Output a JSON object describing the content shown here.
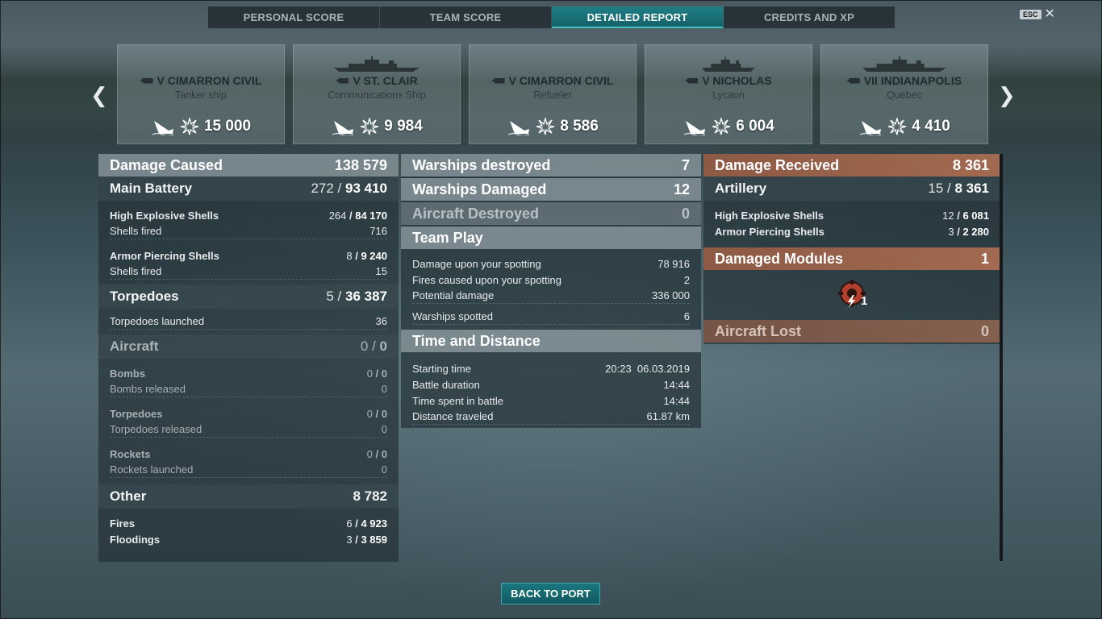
{
  "tabs": [
    {
      "label": "PERSONAL SCORE",
      "active": false
    },
    {
      "label": "TEAM SCORE",
      "active": false
    },
    {
      "label": "DETAILED REPORT",
      "active": true
    },
    {
      "label": "CREDITS AND XP",
      "active": false
    }
  ],
  "esc": {
    "key_label": "ESC",
    "close_glyph": "✕"
  },
  "carousel": {
    "prev_glyph": "❮",
    "next_glyph": "❯",
    "cards": [
      {
        "name": "V CIMARRON CIVIL",
        "class": "Tanker ship",
        "damage": "15 000"
      },
      {
        "name": "V ST. CLAIR",
        "class": "Communications Ship",
        "damage": "9 984"
      },
      {
        "name": "V CIMARRON CIVIL",
        "class": "Refueler",
        "damage": "8 586"
      },
      {
        "name": "V NICHOLAS",
        "class": "Lycaon",
        "damage": "6 004"
      },
      {
        "name": "VII INDIANAPOLIS",
        "class": "Quebec",
        "damage": "4 410"
      }
    ]
  },
  "left": {
    "damage_caused": {
      "label": "Damage Caused",
      "value": "138 579"
    },
    "main_battery": {
      "label": "Main Battery",
      "hits": "272",
      "value": "93 410"
    },
    "he": {
      "label": "High Explosive Shells",
      "hits": "264",
      "value": "84 170"
    },
    "he_fired": {
      "label": "Shells fired",
      "value": "716"
    },
    "ap": {
      "label": "Armor Piercing Shells",
      "hits": "8",
      "value": "9 240"
    },
    "ap_fired": {
      "label": "Shells fired",
      "value": "15"
    },
    "torpedoes": {
      "label": "Torpedoes",
      "hits": "5",
      "value": "36 387"
    },
    "torpedoes_launched": {
      "label": "Torpedoes launched",
      "value": "36"
    },
    "aircraft": {
      "label": "Aircraft",
      "hits": "0",
      "value": "0"
    },
    "bombs": {
      "label": "Bombs",
      "hits": "0",
      "value": "0"
    },
    "bombs_released": {
      "label": "Bombs released",
      "value": "0"
    },
    "air_torps": {
      "label": "Torpedoes",
      "hits": "0",
      "value": "0"
    },
    "air_torps_released": {
      "label": "Torpedoes released",
      "value": "0"
    },
    "rockets": {
      "label": "Rockets",
      "hits": "0",
      "value": "0"
    },
    "rockets_launched": {
      "label": "Rockets launched",
      "value": "0"
    },
    "other": {
      "label": "Other",
      "value": "8 782"
    },
    "fires": {
      "label": "Fires",
      "hits": "6",
      "value": "4 923"
    },
    "floodings": {
      "label": "Floodings",
      "hits": "3",
      "value": "3 859"
    }
  },
  "mid": {
    "destroyed": {
      "label": "Warships destroyed",
      "value": "7"
    },
    "damaged": {
      "label": "Warships Damaged",
      "value": "12"
    },
    "aircraft_destroyed": {
      "label": "Aircraft Destroyed",
      "value": "0"
    },
    "team_play": {
      "label": "Team Play"
    },
    "spot_damage": {
      "label": "Damage upon your spotting",
      "value": "78 916"
    },
    "spot_fires": {
      "label": "Fires caused upon your spotting",
      "value": "2"
    },
    "potential": {
      "label": "Potential damage",
      "value": "336 000"
    },
    "spotted": {
      "label": "Warships spotted",
      "value": "6"
    },
    "time_distance": {
      "label": "Time and Distance"
    },
    "start": {
      "label": "Starting time",
      "value": "20:23  06.03.2019"
    },
    "duration": {
      "label": "Battle duration",
      "value": "14:44"
    },
    "time_spent": {
      "label": "Time spent in battle",
      "value": "14:44"
    },
    "distance": {
      "label": "Distance traveled",
      "value": "61.87 km"
    }
  },
  "right": {
    "received": {
      "label": "Damage Received",
      "value": "8 361"
    },
    "artillery": {
      "label": "Artillery",
      "hits": "15",
      "value": "8 361"
    },
    "he": {
      "label": "High Explosive Shells",
      "hits": "12",
      "value": "6 081"
    },
    "ap": {
      "label": "Armor Piercing Shells",
      "hits": "3",
      "value": "2 280"
    },
    "modules": {
      "label": "Damaged Modules",
      "value": "1"
    },
    "module_count": "1",
    "aircraft_lost": {
      "label": "Aircraft Lost",
      "value": "0"
    }
  },
  "back_button": "BACK TO PORT",
  "colors": {
    "accent_teal": "#1b777e",
    "received_orange": "#a26a50"
  }
}
